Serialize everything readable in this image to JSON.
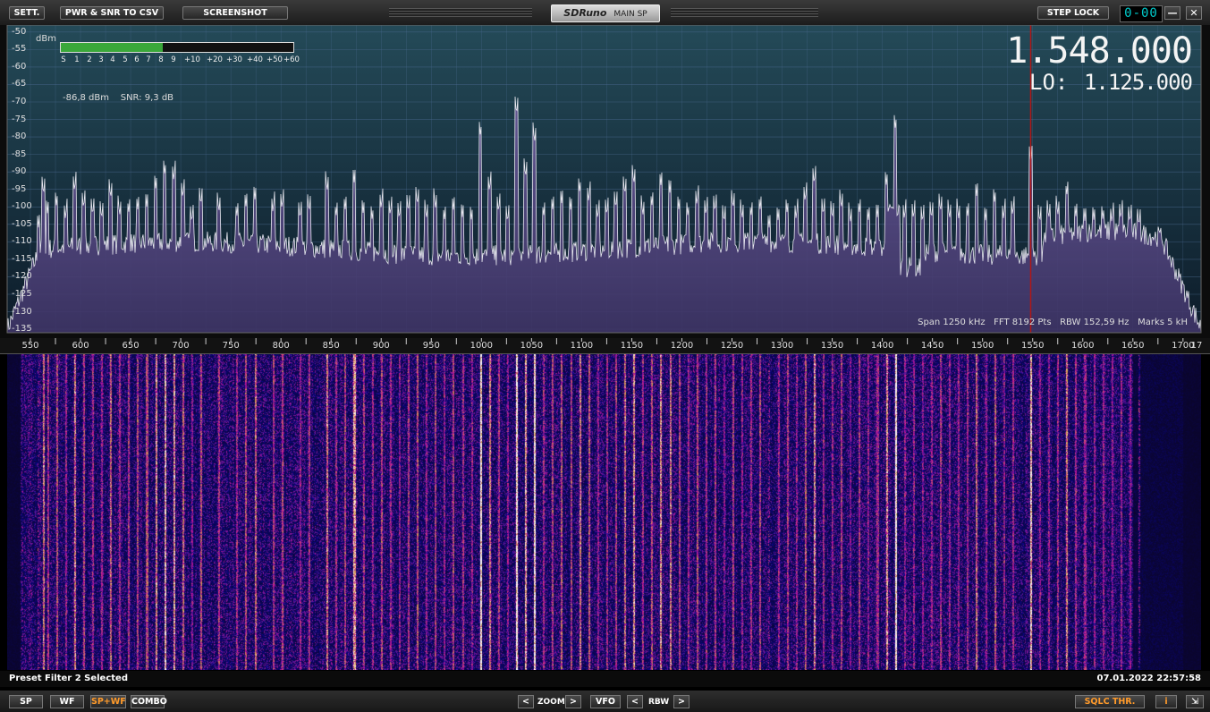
{
  "topbar": {
    "settings_label": "SETT.",
    "pwr_snr_label": "PWR & SNR TO CSV",
    "screenshot_label": "SCREENSHOT",
    "logo_brand": "SDRuno",
    "logo_window": "MAIN SP",
    "step_lock_label": "STEP LOCK",
    "digits": "0-00",
    "minimize_symbol": "—",
    "close_symbol": "✕"
  },
  "spectrum": {
    "dbm_unit": "dBm",
    "y_ticks": [
      "-50",
      "-55",
      "-60",
      "-65",
      "-70",
      "-75",
      "-80",
      "-85",
      "-90",
      "-95",
      "-100",
      "-105",
      "-110",
      "-115",
      "-120",
      "-125",
      "-130",
      "-135"
    ],
    "smeter_scale": [
      "S",
      "1",
      "2",
      "3",
      "4",
      "5",
      "6",
      "7",
      "8",
      "9",
      "+10",
      "+20",
      "+30",
      "+40",
      "+50",
      "+60"
    ],
    "smeter_level": 0.44,
    "readout": "-86,8 dBm    SNR: 9,3 dB",
    "frequency": "1.548.000",
    "lo_label": "LO:",
    "lo_value": "1.125.000",
    "info": "Span 1250 kHz   FFT 8192 Pts   RBW 152,59 Hz   Marks 5 kH",
    "marker_color": "#b01818",
    "trace_color": "#e8e8f0",
    "fill_color": "#6a5a9a"
  },
  "freqaxis": {
    "ticks": [
      "550",
      "600",
      "650",
      "700",
      "750",
      "800",
      "850",
      "900",
      "950",
      "1000",
      "1050",
      "1100",
      "1150",
      "1200",
      "1250",
      "1300",
      "1350",
      "1400",
      "1450",
      "1500",
      "1550",
      "1600",
      "1650",
      "1700",
      "17"
    ]
  },
  "status": {
    "left": "Preset Filter 2 Selected",
    "right": "07.01.2022 22:57:58"
  },
  "bottombar": {
    "sp_label": "SP",
    "wf_label": "WF",
    "spwf_label": "SP+WF",
    "combo_label": "COMBO",
    "zoom_label": "ZOOM",
    "vfo_label": "VFO",
    "rbw_label": "RBW",
    "prev_symbol": "<",
    "next_symbol": ">",
    "sqlc_label": "SQLC THR.",
    "info_label": "i",
    "resize_symbol": "⇲"
  }
}
